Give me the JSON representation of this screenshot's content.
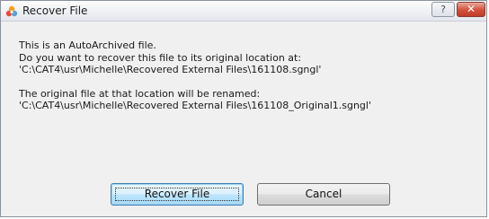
{
  "window": {
    "title": "Recover File",
    "help_symbol": "?",
    "close_symbol": "✕"
  },
  "message": {
    "line1": "This is an AutoArchived file.",
    "line2": "Do you want to recover this file to its original location at:",
    "line3": "'C:\\CAT4\\usr\\Michelle\\Recovered External Files\\161108.sgngl'",
    "line4": "The original file at that location will be renamed:",
    "line5": "'C:\\CAT4\\usr\\Michelle\\Recovered External Files\\161108_Original1.sgngl'"
  },
  "buttons": {
    "recover_label": "Recover File",
    "cancel_label": "Cancel"
  },
  "icons": {
    "app": "app-logo-icon",
    "help": "help-icon",
    "close": "close-icon"
  },
  "colors": {
    "close_button": "#c94a33",
    "default_button_border": "#3c7fb1",
    "window_background": "#f0f0f0"
  }
}
